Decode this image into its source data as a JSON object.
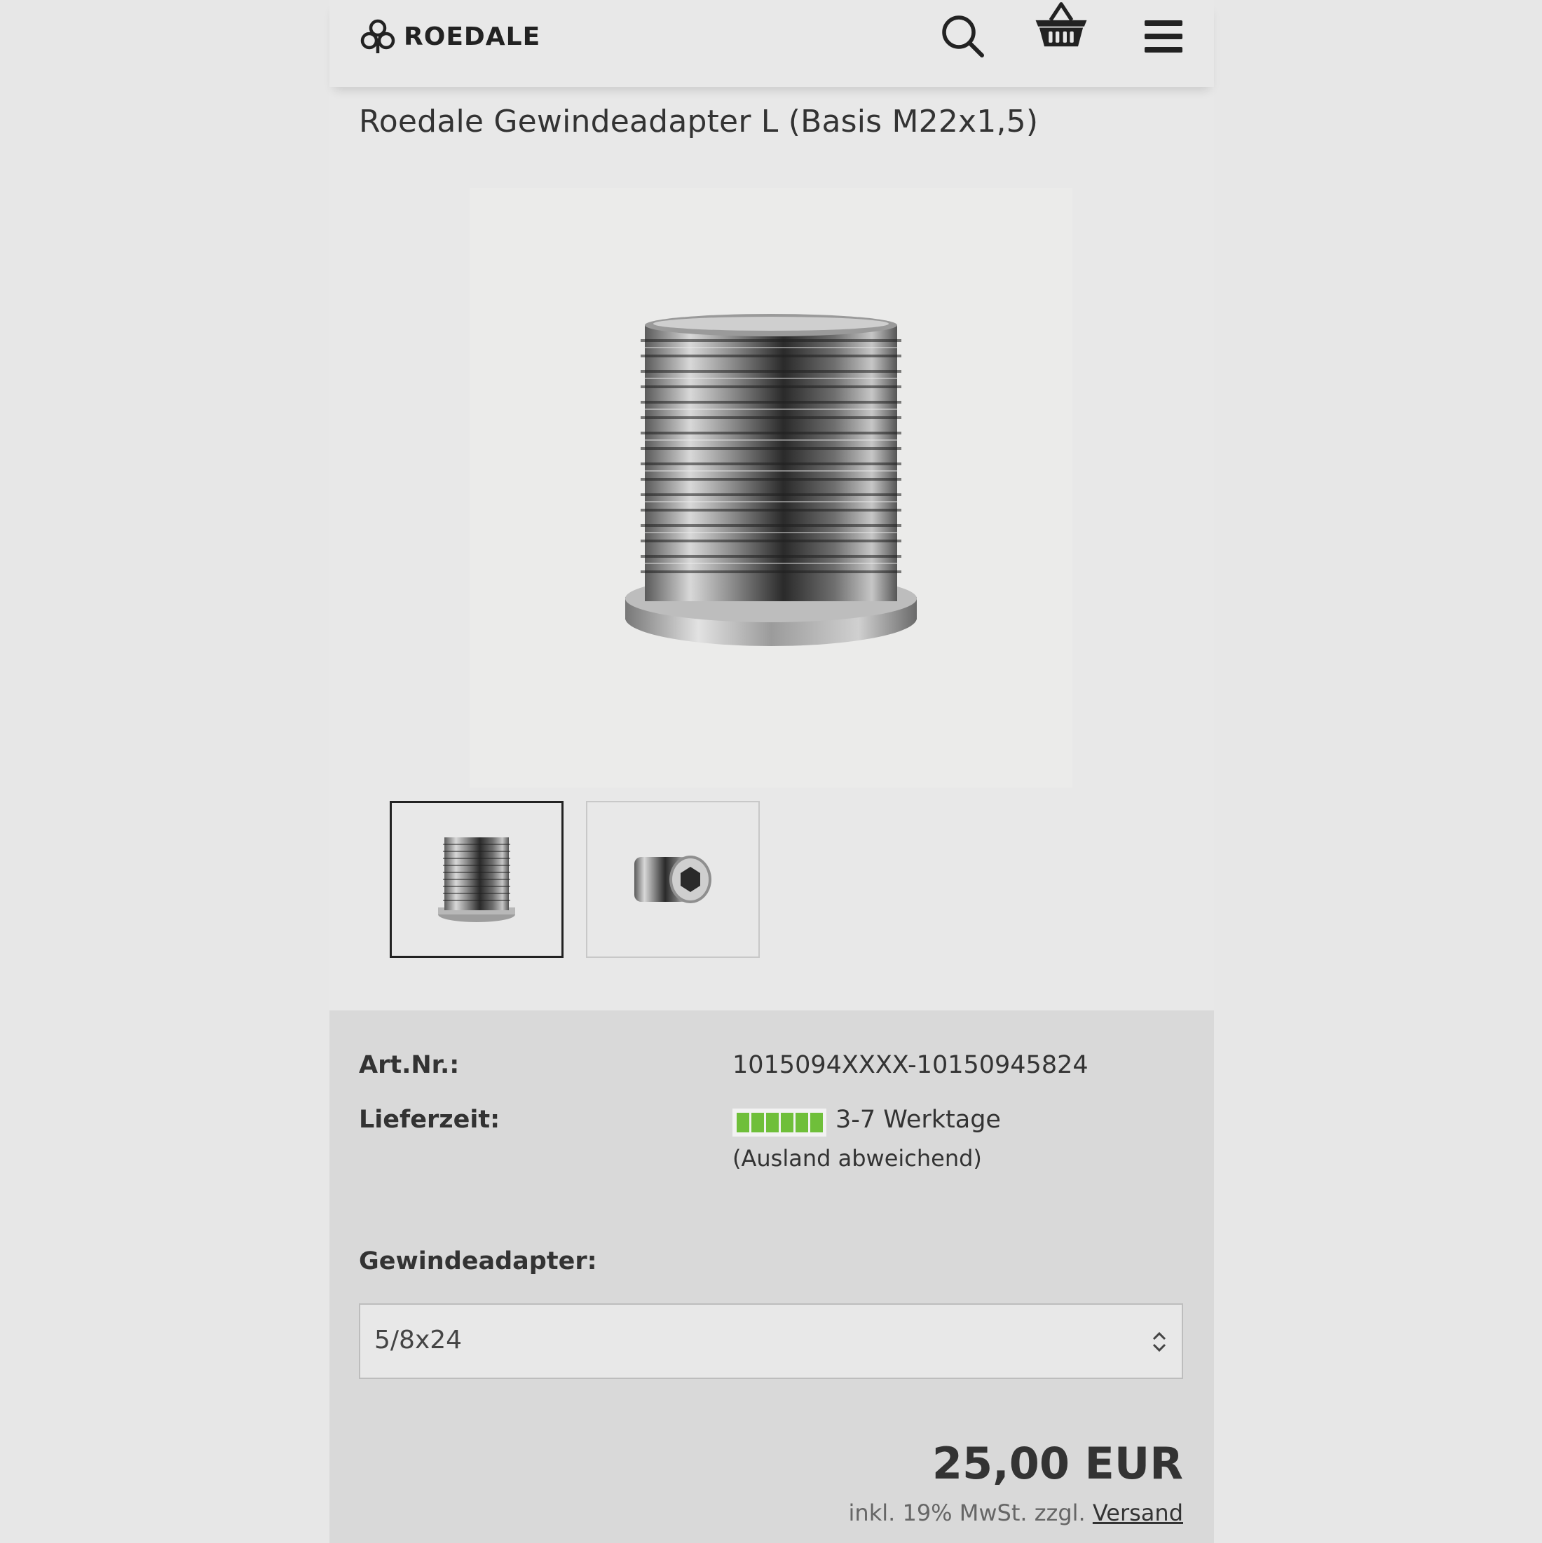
{
  "header": {
    "brand": "ROEDALE",
    "icons": {
      "logo": "clover-logo-icon",
      "search": "search-icon",
      "cart": "basket-icon",
      "menu": "hamburger-menu-icon"
    }
  },
  "product": {
    "title": "Roedale Gewindeadapter L (Basis M22x1,5)",
    "main_image": "threaded-adapter-side-view",
    "thumbnails": [
      "threaded-adapter-side-view",
      "threaded-adapter-hex-end-view"
    ]
  },
  "details": {
    "art_label": "Art.Nr.:",
    "art_value": "1015094XXXX-10150945824",
    "delivery_label": "Lieferzeit:",
    "delivery_value": "3-7 Werktage",
    "delivery_note": "(Ausland abweichend)",
    "delivery_color": "#6fbf3a",
    "variant_label": "Gewindeadapter:",
    "variant_selected": "5/8x24",
    "price": "25,00 EUR",
    "tax_text": "inkl. 19% MwSt. zzgl.",
    "shipping_link": "Versand"
  },
  "colors": {
    "background": "#e8e8e8",
    "panel": "#d9d9d9",
    "text": "#333333"
  }
}
